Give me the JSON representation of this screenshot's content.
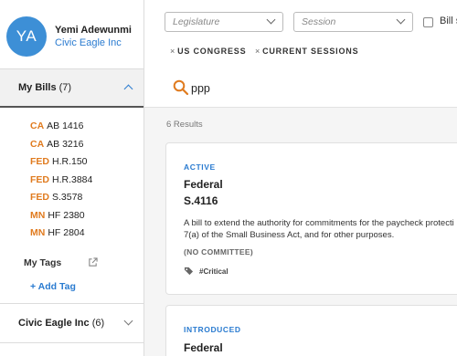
{
  "user": {
    "initials": "YA",
    "name": "Yemi Adewunmi",
    "org": "Civic Eagle Inc"
  },
  "sidebar": {
    "my_bills": {
      "label": "My Bills",
      "count": "(7)"
    },
    "bills": [
      {
        "jurisdiction": "CA",
        "number": "AB 1416"
      },
      {
        "jurisdiction": "CA",
        "number": "AB 3216"
      },
      {
        "jurisdiction": "FED",
        "number": "H.R.150"
      },
      {
        "jurisdiction": "FED",
        "number": "H.R.3884"
      },
      {
        "jurisdiction": "FED",
        "number": "S.3578"
      },
      {
        "jurisdiction": "MN",
        "number": "HF 2380"
      },
      {
        "jurisdiction": "MN",
        "number": "HF 2804"
      }
    ],
    "my_tags": "My Tags",
    "add_tag": "+ Add Tag",
    "group": {
      "label": "Civic Eagle Inc",
      "count": "(6)"
    }
  },
  "filters": {
    "legislature_placeholder": "Legislature",
    "session_placeholder": "Session",
    "checkbox_label": "Bill s",
    "chips": [
      "US CONGRESS",
      "CURRENT SESSIONS"
    ],
    "chip_remove": "×"
  },
  "search": {
    "query": "ppp"
  },
  "results": {
    "count_label": "6 Results",
    "items": [
      {
        "status": "ACTIVE",
        "level": "Federal",
        "bill": "S.4116",
        "description_line1": "A bill to extend the authority for commitments for the paycheck protecti",
        "description_line2": "7(a) of the Small Business Act, and for other purposes.",
        "committee": "(NO COMMITTEE)",
        "tag": "#Critical"
      },
      {
        "status": "INTRODUCED",
        "level": "Federal"
      }
    ]
  },
  "colors": {
    "accent": "#2a7bd0",
    "jurisdiction": "#e07b1f",
    "avatar": "#3d8fd6"
  }
}
